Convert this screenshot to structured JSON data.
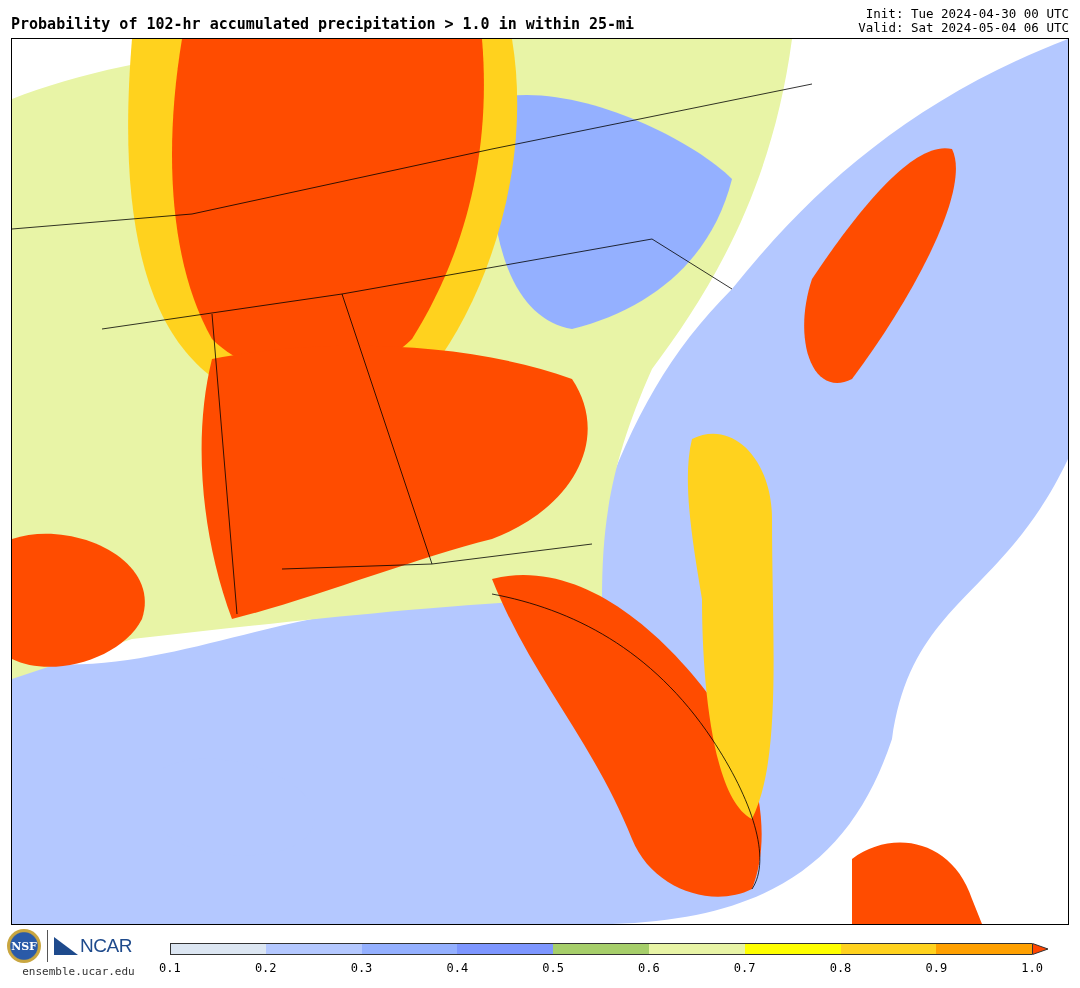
{
  "title": "Probability of 102-hr accumulated precipitation > 1.0 in within 25-mi",
  "init": "Init: Tue 2024-04-30 00 UTC",
  "valid": "Valid: Sat 2024-05-04 06 UTC",
  "logos": [
    {
      "kind": "seal",
      "text": "NSF"
    },
    {
      "kind": "wordmark",
      "text": "NCAR"
    }
  ],
  "website": "ensemble.ucar.edu",
  "colorbar": {
    "bins": [
      {
        "kind": "bin",
        "color": "#dce6f2"
      },
      {
        "kind": "bin",
        "color": "#b4c8ff"
      },
      {
        "kind": "bin",
        "color": "#94b0ff"
      },
      {
        "kind": "bin",
        "color": "#7d96ff"
      },
      {
        "kind": "bin",
        "color": "#a6ce6a"
      },
      {
        "kind": "bin",
        "color": "#e8f4a6"
      },
      {
        "kind": "bin",
        "color": "#ffff00"
      },
      {
        "kind": "bin",
        "color": "#ffd21e"
      },
      {
        "kind": "bin",
        "color": "#ffa000"
      },
      {
        "kind": "extension",
        "color": "#ff4500"
      }
    ],
    "ticks": [
      "0.1",
      "0.2",
      "0.3",
      "0.4",
      "0.5",
      "0.6",
      "0.7",
      "0.8",
      "0.9",
      "1.0"
    ]
  }
}
